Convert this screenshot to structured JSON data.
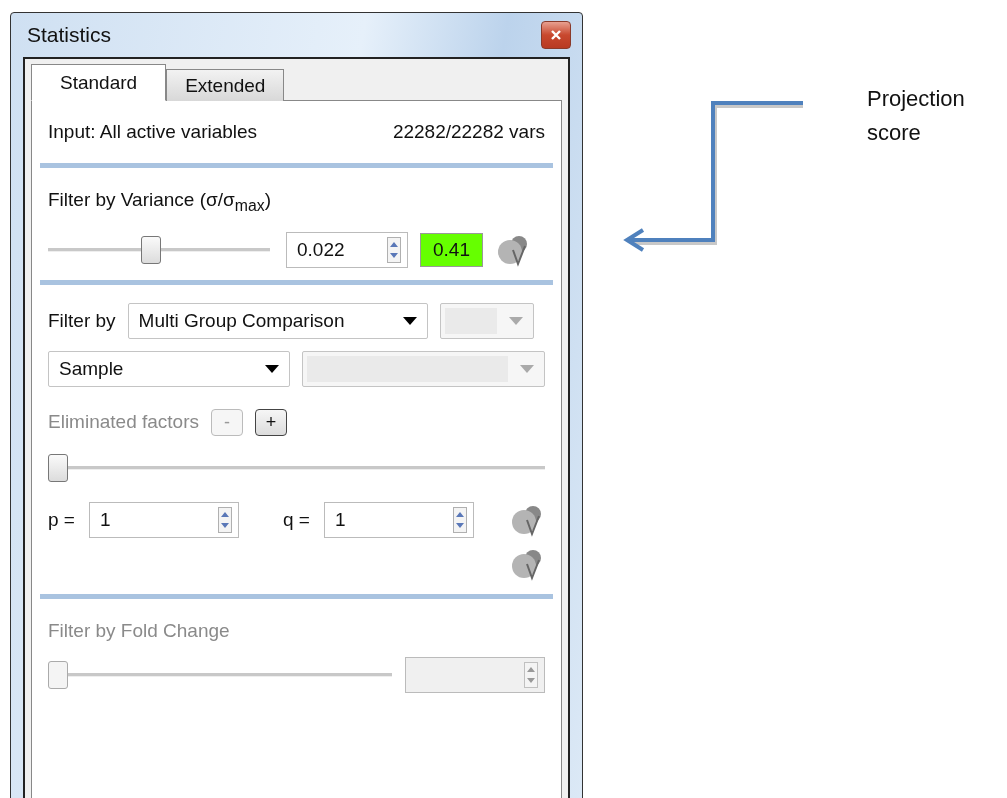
{
  "window": {
    "title": "Statistics"
  },
  "tabs": [
    {
      "label": "Standard",
      "selected": true
    },
    {
      "label": "Extended",
      "selected": false
    }
  ],
  "input": {
    "label": "Input: All active variables",
    "count": "22282/22282 vars"
  },
  "variance": {
    "label": "Filter by Variance (σ/σ$_{max}$)",
    "level": 0.46,
    "value": "0.022",
    "score": "0.41"
  },
  "group_filter": {
    "label": "Filter by",
    "method": "Multi Group Comparison",
    "factor": "Sample",
    "eliminated_label": "Eliminated factors",
    "eliminated_disabled": true,
    "buttons": [
      {
        "label": "-",
        "disabled": true
      },
      {
        "label": "+",
        "disabled": false
      }
    ],
    "level": 0,
    "p_label": "p =",
    "p_value": "1",
    "q_label": "q =",
    "q_value": "1"
  },
  "fold_change": {
    "label": "Filter by Fold Change",
    "disabled": true,
    "level": 0
  },
  "annotation": {
    "label": "Projection score"
  }
}
